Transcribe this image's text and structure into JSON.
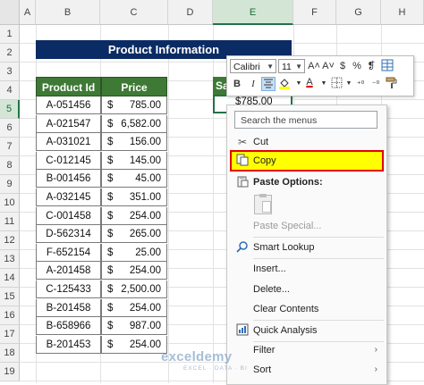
{
  "columns": [
    "A",
    "B",
    "C",
    "D",
    "E",
    "F",
    "G",
    "H"
  ],
  "rows": [
    "1",
    "2",
    "3",
    "4",
    "5",
    "6",
    "7",
    "8",
    "9",
    "10",
    "11",
    "12",
    "13",
    "14",
    "15",
    "16",
    "17",
    "18",
    "19"
  ],
  "title": "Product Information",
  "table": {
    "header_id": "Product Id",
    "header_price": "Price",
    "currency": "$",
    "rows": [
      {
        "id": "A-051456",
        "price": "785.00"
      },
      {
        "id": "A-021547",
        "price": "6,582.00"
      },
      {
        "id": "A-031021",
        "price": "156.00"
      },
      {
        "id": "C-012145",
        "price": "145.00"
      },
      {
        "id": "B-001456",
        "price": "45.00"
      },
      {
        "id": "A-032145",
        "price": "351.00"
      },
      {
        "id": "C-001458",
        "price": "254.00"
      },
      {
        "id": "D-562314",
        "price": "265.00"
      },
      {
        "id": "F-652154",
        "price": "25.00"
      },
      {
        "id": "A-201458",
        "price": "254.00"
      },
      {
        "id": "C-125433",
        "price": "2,500.00"
      },
      {
        "id": "B-201458",
        "price": "254.00"
      },
      {
        "id": "B-658966",
        "price": "987.00"
      },
      {
        "id": "B-201453",
        "price": "254.00"
      }
    ]
  },
  "side_cell": {
    "label": "Sa",
    "value": "$785.00"
  },
  "mini_toolbar": {
    "font": "Calibri",
    "size": "11",
    "grow_font": "A˄",
    "shrink_font": "A˅",
    "currency": "$",
    "percent": "%",
    "comma": "❡",
    "bold": "B",
    "italic": "I",
    "font_color": "A"
  },
  "context_menu": {
    "search_placeholder": "Search the menus",
    "cut": "Cut",
    "copy": "Copy",
    "paste_options": "Paste Options:",
    "paste_special": "Paste Special...",
    "smart_lookup": "Smart Lookup",
    "insert": "Insert...",
    "delete": "Delete...",
    "clear_contents": "Clear Contents",
    "quick_analysis": "Quick Analysis",
    "filter": "Filter",
    "sort": "Sort"
  },
  "watermark": {
    "brand": "exceldemy",
    "tagline": "EXCEL · DATA · BI"
  },
  "colors": {
    "title_bg": "#0b2b64",
    "header_bg": "#3e7a35",
    "highlight": "#ffff00",
    "highlight_border": "#e00000",
    "selection": "#217346"
  }
}
